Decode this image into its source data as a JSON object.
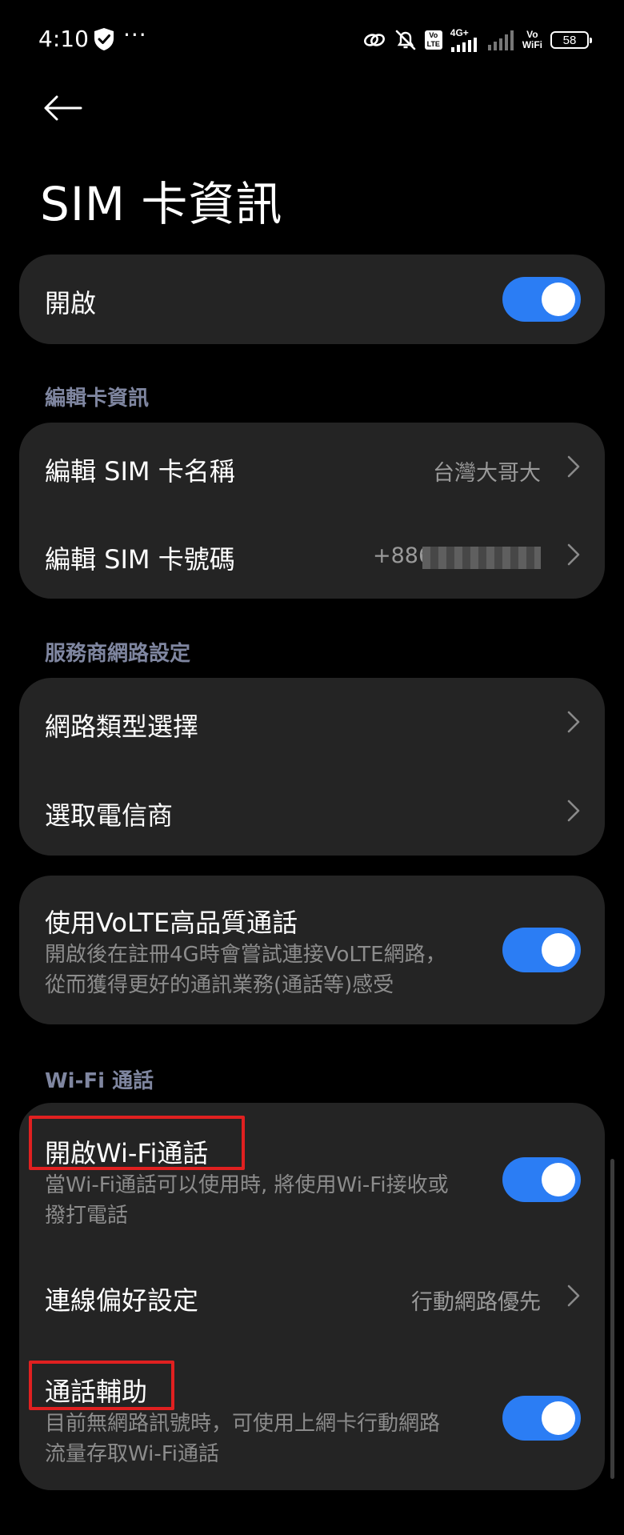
{
  "status_bar": {
    "time": "4:10",
    "dots": "···",
    "network": "4G+",
    "volte_badge": "Vo LTE",
    "vowifi_line1": "Vo",
    "vowifi_line2": "WiFi",
    "battery": "58"
  },
  "header": {
    "title": "SIM 卡資訊"
  },
  "enable_card": {
    "label": "開啟",
    "enabled": true
  },
  "edit_section": {
    "label": "編輯卡資訊",
    "name_row": {
      "title": "編輯 SIM 卡名稱",
      "value": "台灣大哥大"
    },
    "number_row": {
      "title": "編輯 SIM 卡號碼",
      "value": "+886"
    }
  },
  "carrier_section": {
    "label": "服務商網路設定",
    "network_type_row": {
      "title": "網路類型選擇"
    },
    "operator_row": {
      "title": "選取電信商"
    }
  },
  "volte_card": {
    "title": "使用VoLTE高品質通話",
    "subtitle_line1": "開啟後在註冊4G時會嘗試連接VoLTE網路，",
    "subtitle_line2": "從而獲得更好的通訊業務(通話等)感受",
    "enabled": true
  },
  "wifi_section": {
    "label": "Wi-Fi 通話",
    "wifi_calling_row": {
      "title": "開啟Wi-Fi通話",
      "subtitle_line1": "當Wi-Fi通話可以使用時, 將使用Wi-Fi接收或",
      "subtitle_line2": "撥打電話",
      "enabled": true
    },
    "preference_row": {
      "title": "連線偏好設定",
      "value": "行動網路優先"
    },
    "call_assist_row": {
      "title": "通話輔助",
      "subtitle_line1": "目前無網路訊號時，可使用上網卡行動網路",
      "subtitle_line2": "流量存取Wi-Fi通話",
      "enabled": true
    }
  },
  "colors": {
    "background": "#000000",
    "card": "#242424",
    "accent": "#2b7df4",
    "highlight": "#e02020",
    "section_label": "#7f86a0"
  }
}
